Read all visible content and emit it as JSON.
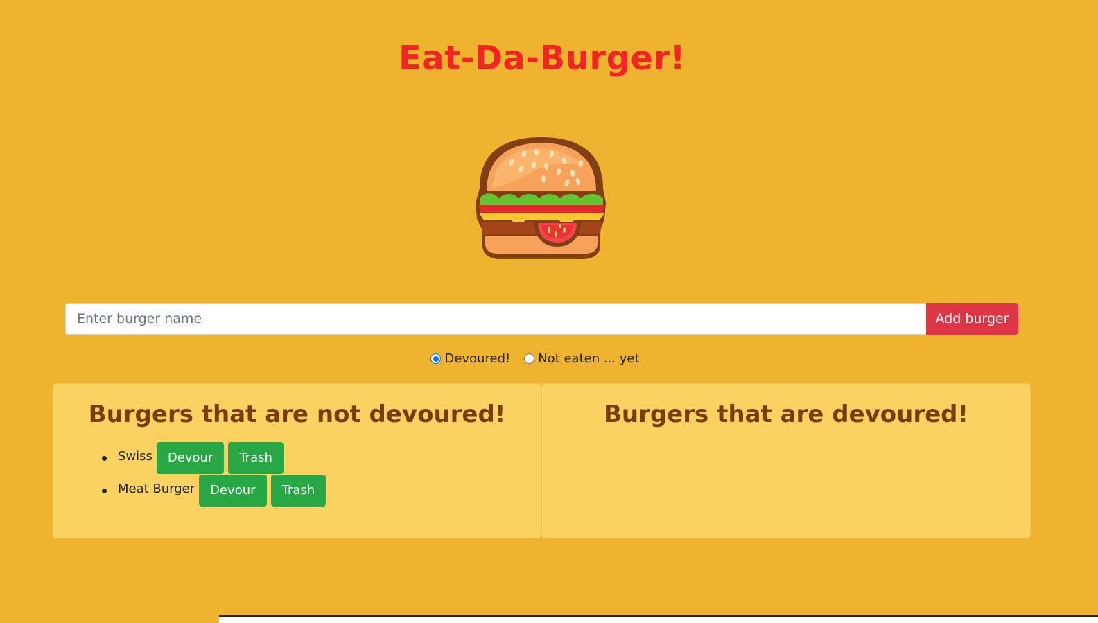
{
  "header": {
    "title": "Eat-Da-Burger!"
  },
  "hero": {
    "image_icon": "burger-illustration"
  },
  "form": {
    "placeholder": "Enter burger name",
    "value": "",
    "add_label": "Add burger",
    "radios": [
      {
        "label": "Devoured!",
        "checked": true
      },
      {
        "label": "Not eaten ... yet",
        "checked": false
      }
    ]
  },
  "not_devoured": {
    "title": "Burgers that are not devoured!",
    "items": [
      {
        "name": "Swiss",
        "devour_label": "Devour",
        "trash_label": "Trash"
      },
      {
        "name": "Meat Burger",
        "devour_label": "Devour",
        "trash_label": "Trash"
      }
    ]
  },
  "devoured": {
    "title": "Burgers that are devoured!",
    "items": []
  },
  "colors": {
    "background": "#efb32f",
    "title": "#f22524",
    "panel": "#f9d262",
    "panel_heading": "#7b3c0b",
    "add_button": "#dc3545",
    "action_button": "#28a745"
  }
}
